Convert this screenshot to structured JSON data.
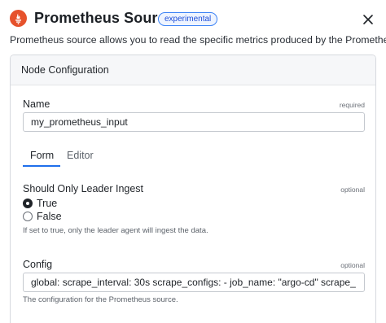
{
  "header": {
    "title": "Prometheus Source",
    "badge": "experimental",
    "logo_icon": "prometheus-logo-icon",
    "close_icon": "close-icon",
    "accent_color": "#e6522c"
  },
  "description": "Prometheus source allows you to read the specific metrics produced by the Prometheus.",
  "panel": {
    "title": "Node Configuration",
    "name_field": {
      "label": "Name",
      "hint": "required",
      "value": "my_prometheus_input"
    },
    "tabs": [
      {
        "label": "Form",
        "active": true
      },
      {
        "label": "Editor",
        "active": false
      }
    ],
    "leader_field": {
      "label": "Should Only Leader Ingest",
      "hint": "optional",
      "options": [
        {
          "label": "True",
          "selected": true
        },
        {
          "label": "False",
          "selected": false
        }
      ],
      "help": "If set to true, only the leader agent will ingest the data."
    },
    "config_field": {
      "label": "Config",
      "hint": "optional",
      "value": "global:   scrape_interval: 30s scrape_configs: - job_name: \"argo-cd\"   scrape_",
      "help": "The configuration for the Prometheus source."
    }
  }
}
